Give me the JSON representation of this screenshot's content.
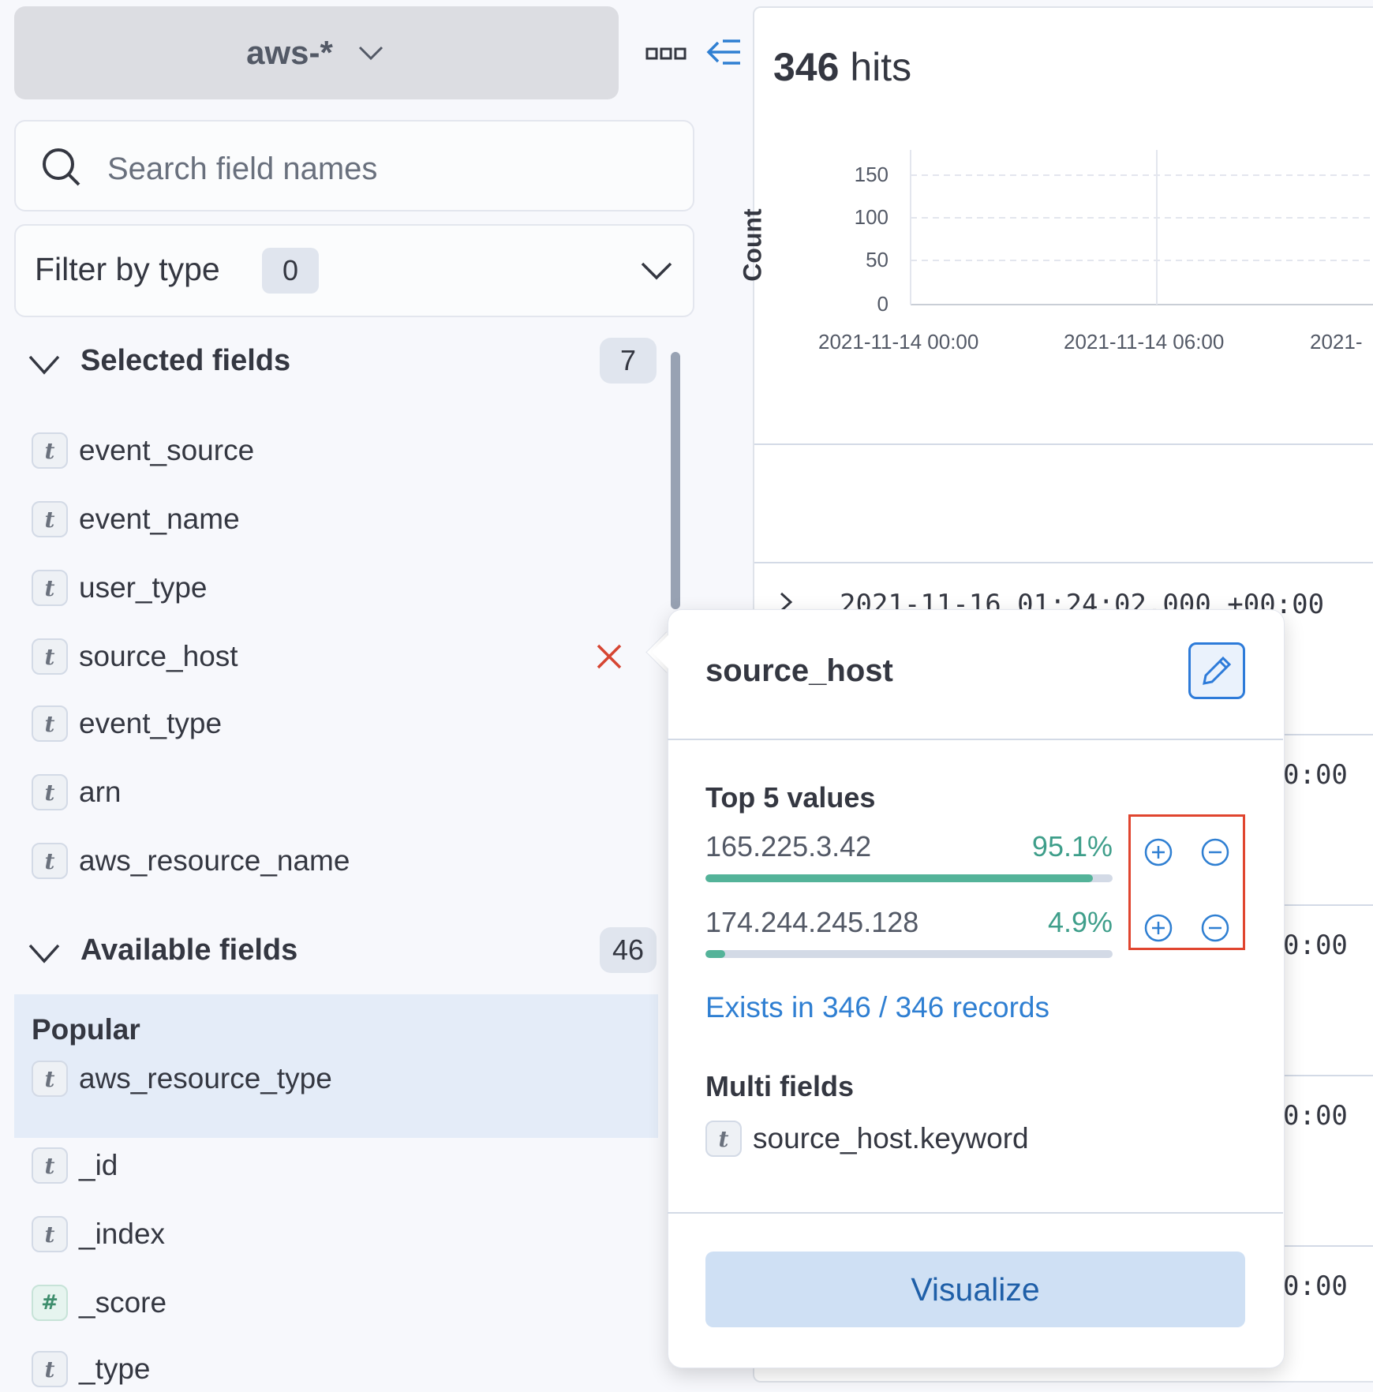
{
  "sidebar": {
    "index_pattern": "aws-*",
    "search": {
      "placeholder": "Search field names",
      "value": ""
    },
    "filter": {
      "label": "Filter by type",
      "count": "0"
    },
    "selected": {
      "title": "Selected fields",
      "count": "7",
      "fields": [
        {
          "type": "t",
          "name": "event_source"
        },
        {
          "type": "t",
          "name": "event_name"
        },
        {
          "type": "t",
          "name": "user_type"
        },
        {
          "type": "t",
          "name": "source_host"
        },
        {
          "type": "t",
          "name": "event_type"
        },
        {
          "type": "t",
          "name": "arn"
        },
        {
          "type": "t",
          "name": "aws_resource_name"
        }
      ]
    },
    "available": {
      "title": "Available fields",
      "count": "46",
      "popular_label": "Popular",
      "popular_fields": [
        {
          "type": "t",
          "name": "aws_resource_type"
        }
      ],
      "fields": [
        {
          "type": "t",
          "name": "_id"
        },
        {
          "type": "t",
          "name": "_index"
        },
        {
          "type": "#",
          "name": "_score"
        },
        {
          "type": "t",
          "name": "_type"
        }
      ]
    }
  },
  "main": {
    "hits_count": "346",
    "hits_label": "hits",
    "rows": [
      "2021-11-16 01:24:02.000 +00:00",
      "0:00",
      "0:00",
      "0:00",
      "0:00"
    ]
  },
  "chart_data": {
    "type": "bar",
    "ylabel": "Count",
    "y_ticks": [
      "150",
      "100",
      "50",
      "0"
    ],
    "x_ticks": [
      "2021-11-14 00:00",
      "2021-11-14 06:00",
      "2021-"
    ],
    "ylim": [
      0,
      150
    ],
    "grid": true
  },
  "popover": {
    "field_name": "source_host",
    "top_values_title": "Top 5 values",
    "values": [
      {
        "value": "165.225.3.42",
        "percent_label": "95.1%",
        "percent": 95.1
      },
      {
        "value": "174.244.245.128",
        "percent_label": "4.9%",
        "percent": 4.9
      }
    ],
    "exists_text": "Exists in 346 / 346 records",
    "multi_fields_title": "Multi fields",
    "multi_fields": [
      {
        "type": "t",
        "name": "source_host.keyword"
      }
    ],
    "visualize_label": "Visualize"
  },
  "colors": {
    "accent": "#2f7fd2",
    "bar_fill": "#54b399",
    "highlight": "#e0452f",
    "remove": "#d64532"
  }
}
